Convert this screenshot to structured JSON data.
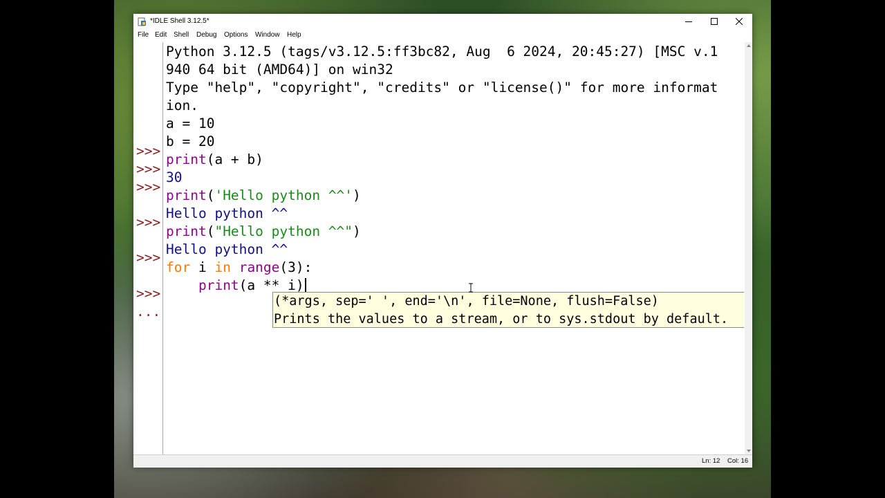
{
  "window": {
    "title": "*IDLE Shell 3.12.5*",
    "controls": [
      "minimize-icon",
      "maximize-icon",
      "close-icon"
    ]
  },
  "menu": [
    "File",
    "Edit",
    "Shell",
    "Debug",
    "Options",
    "Window",
    "Help"
  ],
  "shell": {
    "banner": [
      "Python 3.12.5 (tags/v3.12.5:ff3bc82, Aug  6 2024, 20:45:27) [MSC v.1",
      "940 64 bit (AMD64)] on win32",
      "Type \"help\", \"copyright\", \"credits\" or \"license()\" for more informat",
      "ion."
    ],
    "prompt": ">>>",
    "continuation_prompt": "...",
    "lines": {
      "l5": "a = 10",
      "l6": "b = 20",
      "l7_fn": "print",
      "l7_rest": "(a + b)",
      "l8_out": "30",
      "l9_fn": "print",
      "l9_open": "(",
      "l9_str": "'Hello python ^^'",
      "l9_close": ")",
      "l10_out": "Hello python ^^",
      "l11_fn": "print",
      "l11_open": "(",
      "l11_str": "\"Hello python ^^\"",
      "l11_close": ")",
      "l12_out": "Hello python ^^",
      "l13_kw1": "for",
      "l13_mid": " i ",
      "l13_kw2": "in",
      "l13_sp": " ",
      "l13_fn": "range",
      "l13_rest": "(3):",
      "l14_indent": "    ",
      "l14_fn": "print",
      "l14_rest": "(a ** i)"
    }
  },
  "calltip": {
    "signature": "(*args, sep=' ', end='\\n', file=None, flush=False)",
    "doc": "Prints the values to a stream, or to sys.stdout by default."
  },
  "status": {
    "ln": "Ln: 12",
    "col": "Col: 16"
  },
  "colors": {
    "prompt": "#8b1e1e",
    "output": "#10108a",
    "builtin": "#900090",
    "string": "#1a8a1a",
    "keyword": "#ff7700",
    "calltip_bg": "#ffffe0"
  }
}
